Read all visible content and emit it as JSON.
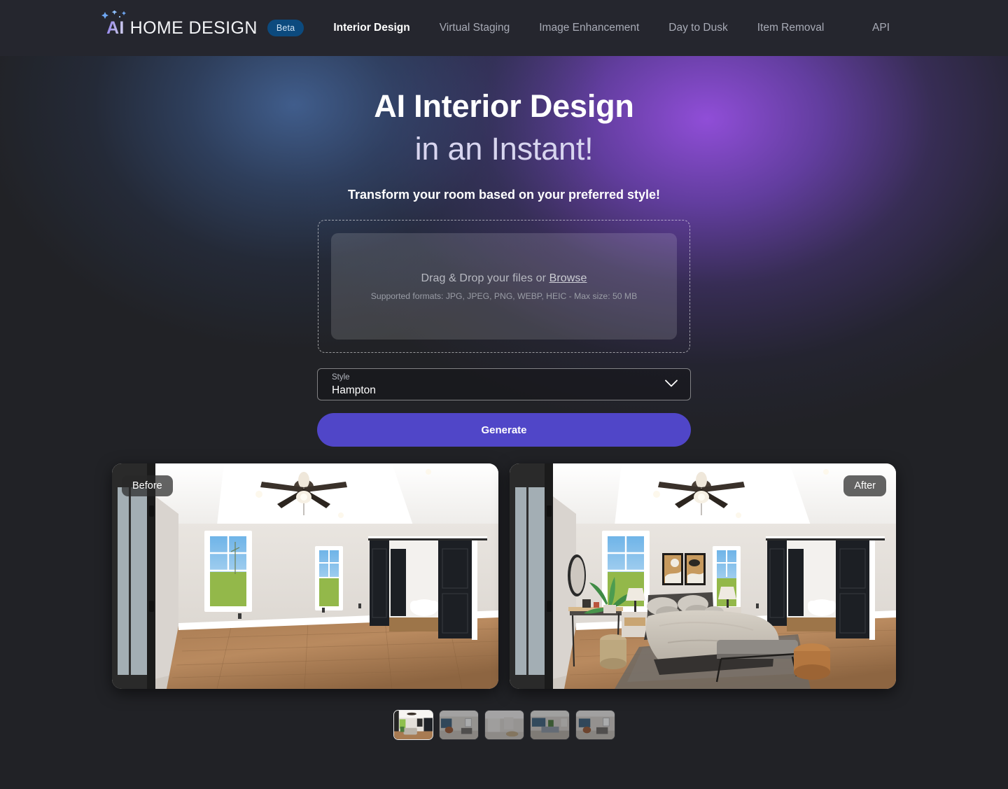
{
  "header": {
    "brand": {
      "ai_text": "AI",
      "word_text": "HOME DESIGN",
      "badge": "Beta",
      "badge_color": "#0c4a7e"
    },
    "nav": [
      {
        "label": "Interior Design",
        "active": true
      },
      {
        "label": "Virtual Staging",
        "active": false
      },
      {
        "label": "Image Enhancement",
        "active": false
      },
      {
        "label": "Day to Dusk",
        "active": false
      },
      {
        "label": "Item Removal",
        "active": false
      }
    ],
    "right_link": "API"
  },
  "hero": {
    "title_line1": "AI Interior Design",
    "title_line2": "in an Instant!",
    "subtitle": "Transform your room based on your preferred style!",
    "glow_purple": "#9650e1",
    "glow_blue": "#486ca5"
  },
  "upload": {
    "drop_prefix": "Drag & Drop your files or ",
    "browse_label": "Browse",
    "formats": "Supported formats: JPG, JPEG, PNG, WEBP, HEIC - Max size: 50 MB"
  },
  "style_field": {
    "label": "Style",
    "value": "Hampton",
    "chevron_icon": "chevron-down-icon"
  },
  "generate": {
    "label": "Generate",
    "color": "#5046c8"
  },
  "compare": {
    "before_badge": "Before",
    "after_badge": "After"
  },
  "thumbnails": [
    {
      "selected": true,
      "name": "staged-bedroom"
    },
    {
      "selected": false,
      "name": "living-room"
    },
    {
      "selected": false,
      "name": "bathroom"
    },
    {
      "selected": false,
      "name": "dining-room"
    },
    {
      "selected": false,
      "name": "lounge"
    }
  ]
}
